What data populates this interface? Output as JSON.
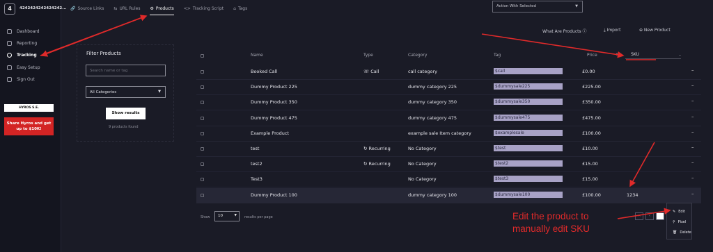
{
  "sidebar": {
    "logo_char": "4",
    "account": "4242424242424242...",
    "items": [
      {
        "label": "Dashboard",
        "icon": "grid-icon"
      },
      {
        "label": "Reporting",
        "icon": "file-icon"
      },
      {
        "label": "Tracking",
        "icon": "target-icon"
      },
      {
        "label": "Easy Setup",
        "icon": "gear-icon"
      },
      {
        "label": "Sign Out",
        "icon": "signout-icon"
      }
    ],
    "hyros_label": "HYROS S.E.",
    "share_label": "Share Hyros and get up to $10K!"
  },
  "tabs": [
    {
      "label": "Source Links",
      "icon": "🔗"
    },
    {
      "label": "URL Rules",
      "icon": "⇆"
    },
    {
      "label": "Products",
      "icon": "⚙"
    },
    {
      "label": "Tracking Script",
      "icon": "<>"
    },
    {
      "label": "Tags",
      "icon": "⌂"
    }
  ],
  "action_select": "Action With Selected",
  "top_links": {
    "what_are_products": "What Are Products ⓘ",
    "import": "⤓ Import",
    "new_product": "⊕ New Product"
  },
  "filter": {
    "title": "Filter Products",
    "search_placeholder": "Search name or tag",
    "category_selected": "All Categories",
    "show_results": "Show results",
    "found_text": "9 products found"
  },
  "table": {
    "headers": {
      "name": "Name",
      "type": "Type",
      "category": "Category",
      "tag": "Tag",
      "price": "Price",
      "sku": "SKU"
    },
    "rows": [
      {
        "name": "Booked Call",
        "type": "☏ Call",
        "category": "call category",
        "tag": "$call",
        "price": "£0.00",
        "sku": ""
      },
      {
        "name": "Dummy Product 225",
        "type": "",
        "category": "dummy category 225",
        "tag": "$dummysale225",
        "price": "£225.00",
        "sku": ""
      },
      {
        "name": "Dummy Product 350",
        "type": "",
        "category": "dummy category 350",
        "tag": "$dummysale350",
        "price": "£350.00",
        "sku": ""
      },
      {
        "name": "Dummy Product 475",
        "type": "",
        "category": "dummy category 475",
        "tag": "$dummysale475",
        "price": "£475.00",
        "sku": ""
      },
      {
        "name": "Example Product",
        "type": "",
        "category": "example sale Item category",
        "tag": "$examplesale",
        "price": "£100.00",
        "sku": ""
      },
      {
        "name": "test",
        "type": "↻ Recurring",
        "category": "No Category",
        "tag": "$test",
        "price": "£10.00",
        "sku": ""
      },
      {
        "name": "test2",
        "type": "↻ Recurring",
        "category": "No Category",
        "tag": "$test2",
        "price": "£15.00",
        "sku": ""
      },
      {
        "name": "Test3",
        "type": "",
        "category": "No Category",
        "tag": "$test3",
        "price": "£15.00",
        "sku": ""
      },
      {
        "name": "Dummy Product 100",
        "type": "",
        "category": "dummy category 100",
        "tag": "$dummysale100",
        "price": "£100.00",
        "sku": "1234"
      }
    ]
  },
  "pagination": {
    "show_label": "Show",
    "per_page_value": "10",
    "per_page_label": "results per page"
  },
  "context_menu": [
    {
      "label": "Edit",
      "icon": "✎"
    },
    {
      "label": "Pixel",
      "icon": "⚲"
    },
    {
      "label": "Delete",
      "icon": "🗑"
    }
  ],
  "annotation": "Edit the product to manually edit SKU",
  "colors": {
    "annotation_red": "#e02a2a",
    "tag_bg": "#a8a2c6",
    "share_bg": "#d32424"
  }
}
